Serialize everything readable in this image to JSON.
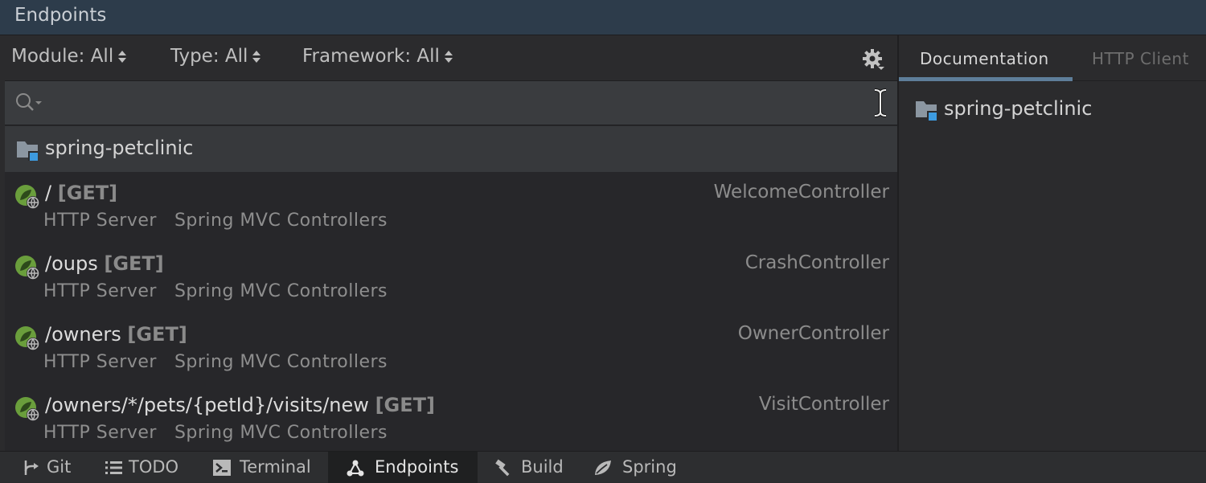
{
  "window": {
    "title": "Endpoints"
  },
  "filters": {
    "module": "Module: All",
    "type": "Type: All",
    "framework": "Framework: All"
  },
  "search": {
    "value": "",
    "placeholder": ""
  },
  "project": {
    "name": "spring-petclinic"
  },
  "endpoints": [
    {
      "path": "/",
      "method": "[GET]",
      "controller": "WelcomeController",
      "server": "HTTP Server",
      "framework": "Spring MVC Controllers"
    },
    {
      "path": "/oups",
      "method": "[GET]",
      "controller": "CrashController",
      "server": "HTTP Server",
      "framework": "Spring MVC Controllers"
    },
    {
      "path": "/owners",
      "method": "[GET]",
      "controller": "OwnerController",
      "server": "HTTP Server",
      "framework": "Spring MVC Controllers"
    },
    {
      "path": "/owners/*/pets/{petId}/visits/new",
      "method": "[GET]",
      "controller": "VisitController",
      "server": "HTTP Server",
      "framework": "Spring MVC Controllers"
    }
  ],
  "right_panel": {
    "tabs": [
      {
        "label": "Documentation",
        "active": true
      },
      {
        "label": "HTTP Client",
        "active": false
      }
    ],
    "doc_title": "spring-petclinic"
  },
  "bottom_tools": [
    {
      "label": "Git",
      "icon": "git-branch-icon"
    },
    {
      "label": "TODO",
      "icon": "list-icon"
    },
    {
      "label": "Terminal",
      "icon": "terminal-icon"
    },
    {
      "label": "Endpoints",
      "icon": "endpoints-icon",
      "active": true
    },
    {
      "label": "Build",
      "icon": "hammer-icon"
    },
    {
      "label": "Spring",
      "icon": "spring-leaf-icon"
    }
  ],
  "colors": {
    "spring_green": "#6a9e3c",
    "folder_blue": "#3d9be0",
    "tab_underline": "#5e7e9a"
  }
}
